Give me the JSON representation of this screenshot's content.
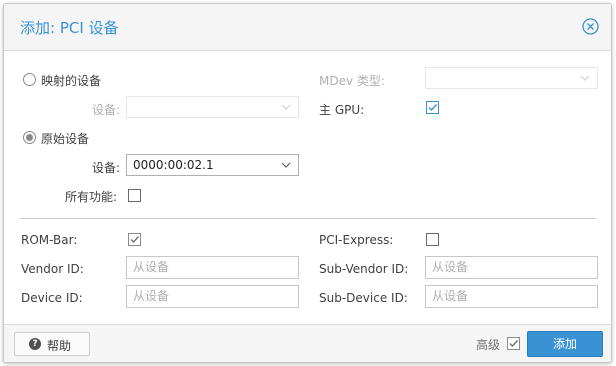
{
  "dialog": {
    "title": "添加: PCI 设备"
  },
  "left": {
    "mapped_label": "映射的设备",
    "mapped_device_label": "设备:",
    "raw_label": "原始设备",
    "raw_device_label": "设备:",
    "raw_device_value": "0000:00:02.1",
    "all_functions_label": "所有功能:"
  },
  "right": {
    "mdev_label": "MDev 类型:",
    "primary_gpu_label": "主 GPU:",
    "primary_gpu_checked": true
  },
  "advanced": {
    "rombar_label": "ROM-Bar:",
    "rombar_checked": true,
    "pcie_label": "PCI-Express:",
    "pcie_checked": false,
    "vendor_label": "Vendor ID:",
    "vendor_placeholder": "从设备",
    "subvendor_label": "Sub-Vendor ID:",
    "subvendor_placeholder": "从设备",
    "device_label": "Device ID:",
    "device_placeholder": "从设备",
    "subdevice_label": "Sub-Device ID:",
    "subdevice_placeholder": "从设备"
  },
  "footer": {
    "help_label": "帮助",
    "advanced_label": "高级",
    "advanced_checked": true,
    "add_label": "添加"
  },
  "colors": {
    "accent": "#3892d4",
    "disabled_text": "#b0b0b0"
  }
}
